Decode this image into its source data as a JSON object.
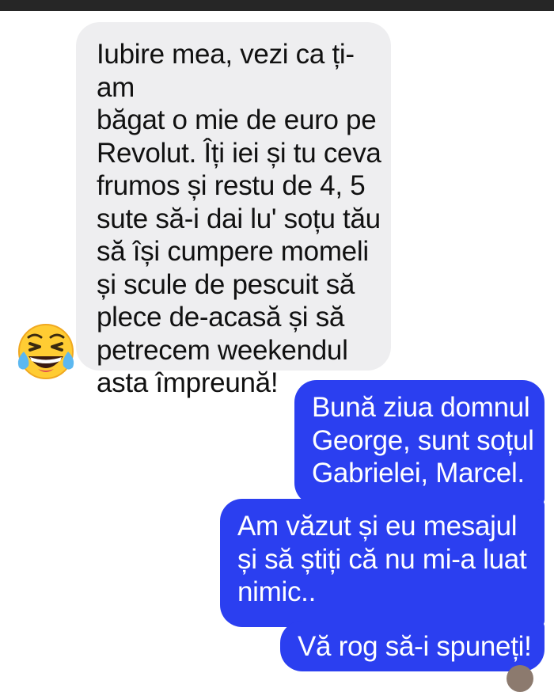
{
  "conversation": {
    "messages": [
      {
        "direction": "received",
        "text": "Iubire mea, vezi ca ți-am\nbăgat o mie de euro pe\nRevolut. Îți iei și tu ceva\nfrumos și restu de 4, 5\nsute să-i dai lu' soțu tău\nsă își cumpere momeli\nși scule de pescuit să\nplece de-acasă și să\npetrecem weekendul\nasta împreună!"
      },
      {
        "direction": "sent",
        "text": "Bună ziua domnul\nGeorge, sunt soțul\nGabrielei, Marcel."
      },
      {
        "direction": "sent",
        "text": "Am văzut și eu mesajul\nși să știți că nu mi-a luat\nnimic.."
      },
      {
        "direction": "sent",
        "text": "Vă rog să-i spuneți!"
      }
    ],
    "reaction": {
      "icon": "laughing-tears-emoji-icon",
      "color": "#ffcc33"
    }
  },
  "colors": {
    "received_bubble": "#eeeef0",
    "sent_bubble": "#2b3ff0",
    "top_bar": "#262626"
  }
}
